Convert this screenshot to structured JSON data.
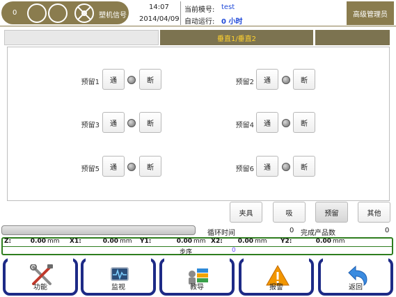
{
  "header": {
    "count": "0",
    "mode": "塑机信号",
    "time": "14:07",
    "date": "2014/04/09",
    "mold_label": "当前模号:",
    "mold_value": "test",
    "run_label": "自动运行:",
    "run_value": "0 小时",
    "admin": "高级管理员",
    "brand_color": "#8a7c4e"
  },
  "tabs": {
    "active": "垂直1/垂直2"
  },
  "reserves": [
    {
      "label": "预留1",
      "on": "通",
      "off": "断"
    },
    {
      "label": "预留2",
      "on": "通",
      "off": "断"
    },
    {
      "label": "预留3",
      "on": "通",
      "off": "断"
    },
    {
      "label": "预留4",
      "on": "通",
      "off": "断"
    },
    {
      "label": "预留5",
      "on": "通",
      "off": "断"
    },
    {
      "label": "预留6",
      "on": "通",
      "off": "断"
    }
  ],
  "pages": [
    "夹具",
    "吸",
    "预留",
    "其他"
  ],
  "status": {
    "cycle_label": "循环时间",
    "cycle_value": "0",
    "finished_label": "完成产品数",
    "finished_value": "0"
  },
  "coords": [
    {
      "axis": "Z:",
      "value": "0.00",
      "unit": "mm"
    },
    {
      "axis": "X1:",
      "value": "0.00",
      "unit": "mm"
    },
    {
      "axis": "Y1:",
      "value": "0.00",
      "unit": "mm"
    },
    {
      "axis": "X2:",
      "value": "0.00",
      "unit": "mm"
    },
    {
      "axis": "Y2:",
      "value": "0.00",
      "unit": "mm"
    }
  ],
  "step": {
    "label": "步序",
    "value": "0"
  },
  "nav": [
    {
      "label": "功能",
      "icon": "tools-icon"
    },
    {
      "label": "监视",
      "icon": "monitor-icon"
    },
    {
      "label": "教导",
      "icon": "teach-icon"
    },
    {
      "label": "报警",
      "icon": "warning-icon"
    },
    {
      "label": "返回",
      "icon": "back-arrow-icon"
    }
  ]
}
